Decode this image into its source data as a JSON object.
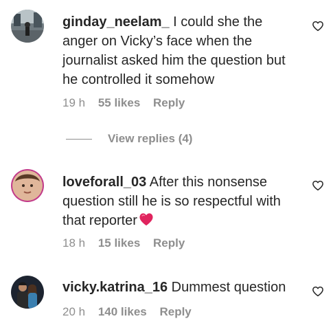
{
  "comments": [
    {
      "username": "ginday_neelam_",
      "text": " I could she the anger on Vicky’s face when the journalist asked him the question but he controlled it somehow",
      "time": "19 h",
      "likes": "55 likes",
      "reply": "Reply",
      "avatar_icon": "avatar-photo-street"
    },
    {
      "username": "loveforall_03",
      "text": " After this nonsense question still he is so respectful with that reporter",
      "emoji": "red-heart",
      "time": "18 h",
      "likes": "15 likes",
      "reply": "Reply",
      "avatar_icon": "avatar-photo-portrait"
    },
    {
      "username": "vicky.katrina_16",
      "text": " Dummest question",
      "time": "20 h",
      "likes": "140 likes",
      "reply": "Reply",
      "avatar_icon": "avatar-photo-couple"
    }
  ],
  "view_replies": "View replies (4)",
  "colors": {
    "text": "#262626",
    "muted": "#8e8e8e",
    "heart_emoji": "#e0245e"
  }
}
